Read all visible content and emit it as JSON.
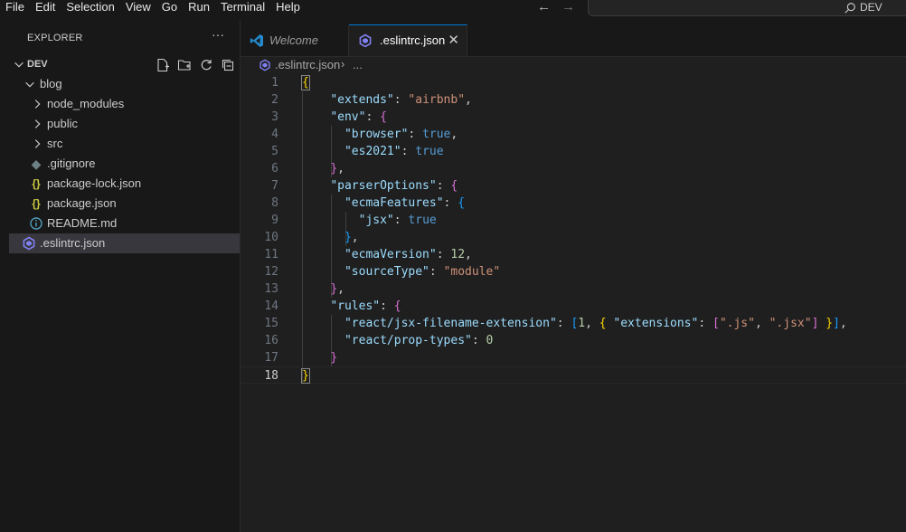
{
  "menu": [
    "File",
    "Edit",
    "Selection",
    "View",
    "Go",
    "Run",
    "Terminal",
    "Help"
  ],
  "nav": {
    "back_icon": "arrow-left-icon",
    "forward_icon": "arrow-right-icon"
  },
  "command_center": {
    "label": "DEV",
    "icon": "search-icon"
  },
  "sidebar": {
    "title": "EXPLORER",
    "more": "···",
    "section": "DEV",
    "actions": [
      "new-file-icon",
      "new-folder-icon",
      "refresh-icon",
      "collapse-all-icon"
    ],
    "items": [
      {
        "label": "blog",
        "type": "folder-open"
      },
      {
        "label": "node_modules",
        "type": "folder"
      },
      {
        "label": "public",
        "type": "folder"
      },
      {
        "label": "src",
        "type": "folder"
      },
      {
        "label": ".gitignore",
        "type": "file-git"
      },
      {
        "label": "package-lock.json",
        "type": "file-json"
      },
      {
        "label": "package.json",
        "type": "file-json"
      },
      {
        "label": "README.md",
        "type": "file-info"
      },
      {
        "label": ".eslintrc.json",
        "type": "file-eslint"
      }
    ]
  },
  "tabs": [
    {
      "label": "Welcome",
      "icon": "vscode-logo-icon",
      "active": false
    },
    {
      "label": ".eslintrc.json",
      "icon": "eslint-icon",
      "active": true,
      "close": "✕"
    }
  ],
  "breadcrumb": {
    "file": ".eslintrc.json",
    "separator": "›",
    "more": "..."
  },
  "editor": {
    "current_line": 18,
    "line_numbers": [
      "1",
      "2",
      "3",
      "4",
      "5",
      "6",
      "7",
      "8",
      "9",
      "10",
      "11",
      "12",
      "13",
      "14",
      "15",
      "16",
      "17",
      "18"
    ],
    "lines": [
      [
        [
          "{",
          "br1"
        ]
      ],
      [
        [
          "    ",
          "p"
        ],
        [
          "\"extends\"",
          "k"
        ],
        [
          ": ",
          "p"
        ],
        [
          "\"airbnb\"",
          "s"
        ],
        [
          ",",
          "p"
        ]
      ],
      [
        [
          "    ",
          "p"
        ],
        [
          "\"env\"",
          "k"
        ],
        [
          ": ",
          "p"
        ],
        [
          "{",
          "br2"
        ]
      ],
      [
        [
          "      ",
          "p"
        ],
        [
          "\"browser\"",
          "k"
        ],
        [
          ": ",
          "p"
        ],
        [
          "true",
          "b"
        ],
        [
          ",",
          "p"
        ]
      ],
      [
        [
          "      ",
          "p"
        ],
        [
          "\"es2021\"",
          "k"
        ],
        [
          ": ",
          "p"
        ],
        [
          "true",
          "b"
        ]
      ],
      [
        [
          "    ",
          "p"
        ],
        [
          "}",
          "br2"
        ],
        [
          ",",
          "p"
        ]
      ],
      [
        [
          "    ",
          "p"
        ],
        [
          "\"parserOptions\"",
          "k"
        ],
        [
          ": ",
          "p"
        ],
        [
          "{",
          "br2"
        ]
      ],
      [
        [
          "      ",
          "p"
        ],
        [
          "\"ecmaFeatures\"",
          "k"
        ],
        [
          ": ",
          "p"
        ],
        [
          "{",
          "br3"
        ]
      ],
      [
        [
          "        ",
          "p"
        ],
        [
          "\"jsx\"",
          "k"
        ],
        [
          ": ",
          "p"
        ],
        [
          "true",
          "b"
        ]
      ],
      [
        [
          "      ",
          "p"
        ],
        [
          "}",
          "br3"
        ],
        [
          ",",
          "p"
        ]
      ],
      [
        [
          "      ",
          "p"
        ],
        [
          "\"ecmaVersion\"",
          "k"
        ],
        [
          ": ",
          "p"
        ],
        [
          "12",
          "n"
        ],
        [
          ",",
          "p"
        ]
      ],
      [
        [
          "      ",
          "p"
        ],
        [
          "\"sourceType\"",
          "k"
        ],
        [
          ": ",
          "p"
        ],
        [
          "\"module\"",
          "s"
        ]
      ],
      [
        [
          "    ",
          "p"
        ],
        [
          "}",
          "br2"
        ],
        [
          ",",
          "p"
        ]
      ],
      [
        [
          "    ",
          "p"
        ],
        [
          "\"rules\"",
          "k"
        ],
        [
          ": ",
          "p"
        ],
        [
          "{",
          "br2"
        ]
      ],
      [
        [
          "      ",
          "p"
        ],
        [
          "\"react/jsx-filename-extension\"",
          "k"
        ],
        [
          ": ",
          "p"
        ],
        [
          "[",
          "br3"
        ],
        [
          "1",
          "n"
        ],
        [
          ", ",
          "p"
        ],
        [
          "{",
          "br1"
        ],
        [
          " ",
          "p"
        ],
        [
          "\"extensions\"",
          "k"
        ],
        [
          ": ",
          "p"
        ],
        [
          "[",
          "br2"
        ],
        [
          "\".js\"",
          "s"
        ],
        [
          ", ",
          "p"
        ],
        [
          "\".jsx\"",
          "s"
        ],
        [
          "]",
          "br2"
        ],
        [
          " ",
          "p"
        ],
        [
          "}",
          "br1"
        ],
        [
          "]",
          "br3"
        ],
        [
          ",",
          "p"
        ]
      ],
      [
        [
          "      ",
          "p"
        ],
        [
          "\"react/prop-types\"",
          "k"
        ],
        [
          ": ",
          "p"
        ],
        [
          "0",
          "n"
        ]
      ],
      [
        [
          "    ",
          "p"
        ],
        [
          "}",
          "br2"
        ]
      ],
      [
        [
          "}",
          "br1"
        ]
      ]
    ]
  },
  "colors": {
    "accent": "#0078d4",
    "eslint": "#8080f2",
    "json": "#cbcb41",
    "info": "#519aba",
    "vscode": "#2489ca"
  }
}
